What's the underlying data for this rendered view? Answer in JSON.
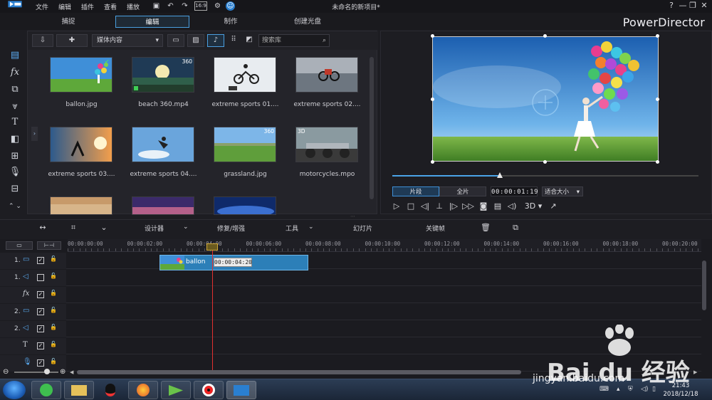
{
  "menu": [
    "文件",
    "编辑",
    "插件",
    "查看",
    "播放"
  ],
  "window_title": "未命名的新项目*",
  "window_buttons": [
    "?",
    "—",
    "❐",
    "✕"
  ],
  "modes": [
    {
      "label": "捕捉",
      "active": false
    },
    {
      "label": "编辑",
      "active": true
    },
    {
      "label": "制作",
      "active": false
    },
    {
      "label": "创建光盘",
      "active": false
    }
  ],
  "brand": "PowerDirector",
  "library": {
    "filter": "媒体内容",
    "search_placeholder": "搜索库",
    "items": [
      {
        "name": "ballon.jpg",
        "badge": "",
        "kind": "balloon"
      },
      {
        "name": "beach 360.mp4",
        "badge": "360",
        "kind": "beach"
      },
      {
        "name": "extreme sports 01....",
        "badge": "",
        "kind": "bike1"
      },
      {
        "name": "extreme sports 02....",
        "badge": "",
        "kind": "bike2"
      },
      {
        "name": "extreme sports 03....",
        "badge": "",
        "kind": "sunset"
      },
      {
        "name": "extreme sports 04....",
        "badge": "",
        "kind": "sky"
      },
      {
        "name": "grassland.jpg",
        "badge": "360",
        "kind": "grass"
      },
      {
        "name": "motorcycles.mpo",
        "badge": "3D",
        "kind": "moto"
      },
      {
        "name": "",
        "badge": "",
        "kind": "beach2"
      },
      {
        "name": "",
        "badge": "",
        "kind": "dusk"
      },
      {
        "name": "",
        "badge": "",
        "kind": "blue"
      }
    ]
  },
  "preview": {
    "tab_clip": "片段",
    "tab_movie": "全片",
    "timecode": "00:00:01:19",
    "fit": "适合大小",
    "mode_3d": "3D",
    "progress": 0.35
  },
  "edit_toolbar": {
    "designer": "设计器",
    "fix_enhance": "修复/增强",
    "tools": "工具",
    "slideshow": "幻灯片",
    "keyframe": "关键帧"
  },
  "timeline": {
    "ticks": [
      "00:00:00:00",
      "00:00:02:00",
      "00:00:04:00",
      "00:00:06:00",
      "00:00:08:00",
      "00:00:10:00",
      "00:00:12:00",
      "00:00:14:00",
      "00:00:16:00",
      "00:00:18:00",
      "00:00:20:00"
    ],
    "tracks": [
      {
        "label": "1.",
        "icon": "video-track-icon",
        "glyph": "▭"
      },
      {
        "label": "1.",
        "icon": "audio-track-icon",
        "glyph": "◁"
      },
      {
        "label": "",
        "icon": "fx-track-icon",
        "glyph": "fx"
      },
      {
        "label": "2.",
        "icon": "video-track-icon",
        "glyph": "▭"
      },
      {
        "label": "2.",
        "icon": "audio-track-icon",
        "glyph": "◁"
      },
      {
        "label": "",
        "icon": "title-track-icon",
        "glyph": "T"
      },
      {
        "label": "",
        "icon": "voice-track-icon",
        "glyph": "🎙"
      }
    ],
    "clip_label": "ballon",
    "tooltip": "00:00:04:20"
  },
  "taskbar": {
    "time": "21:43",
    "date": "2018/12/18"
  },
  "watermark": {
    "brand": "Bai du 经验",
    "url": "jingyan.baidu.com"
  }
}
